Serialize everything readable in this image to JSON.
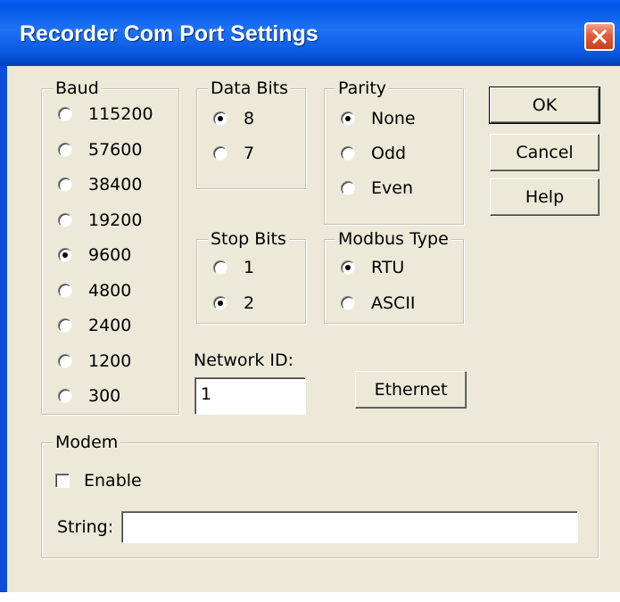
{
  "window": {
    "title": "Recorder Com Port Settings",
    "close_icon": "close-icon",
    "titlebar_color": "#0a5ae0",
    "close_color": "#e15d39"
  },
  "baud": {
    "legend": "Baud",
    "options": [
      "115200",
      "57600",
      "38400",
      "19200",
      "9600",
      "4800",
      "2400",
      "1200",
      "300"
    ],
    "selected": "9600"
  },
  "data_bits": {
    "legend": "Data Bits",
    "options": [
      "8",
      "7"
    ],
    "selected": "8"
  },
  "stop_bits": {
    "legend": "Stop Bits",
    "options": [
      "1",
      "2"
    ],
    "selected": "2"
  },
  "parity": {
    "legend": "Parity",
    "options": [
      "None",
      "Odd",
      "Even"
    ],
    "selected": "None"
  },
  "modbus_type": {
    "legend": "Modbus Type",
    "options": [
      "RTU",
      "ASCII"
    ],
    "selected": "RTU"
  },
  "buttons": {
    "ok": "OK",
    "cancel": "Cancel",
    "help": "Help",
    "ethernet": "Ethernet"
  },
  "network_id": {
    "label": "Network ID:",
    "value": "1"
  },
  "modem": {
    "legend": "Modem",
    "enable_label": "Enable",
    "enable_checked": false,
    "string_label": "String:",
    "string_value": ""
  },
  "colors": {
    "dialog_bg": "#ece9d8"
  }
}
